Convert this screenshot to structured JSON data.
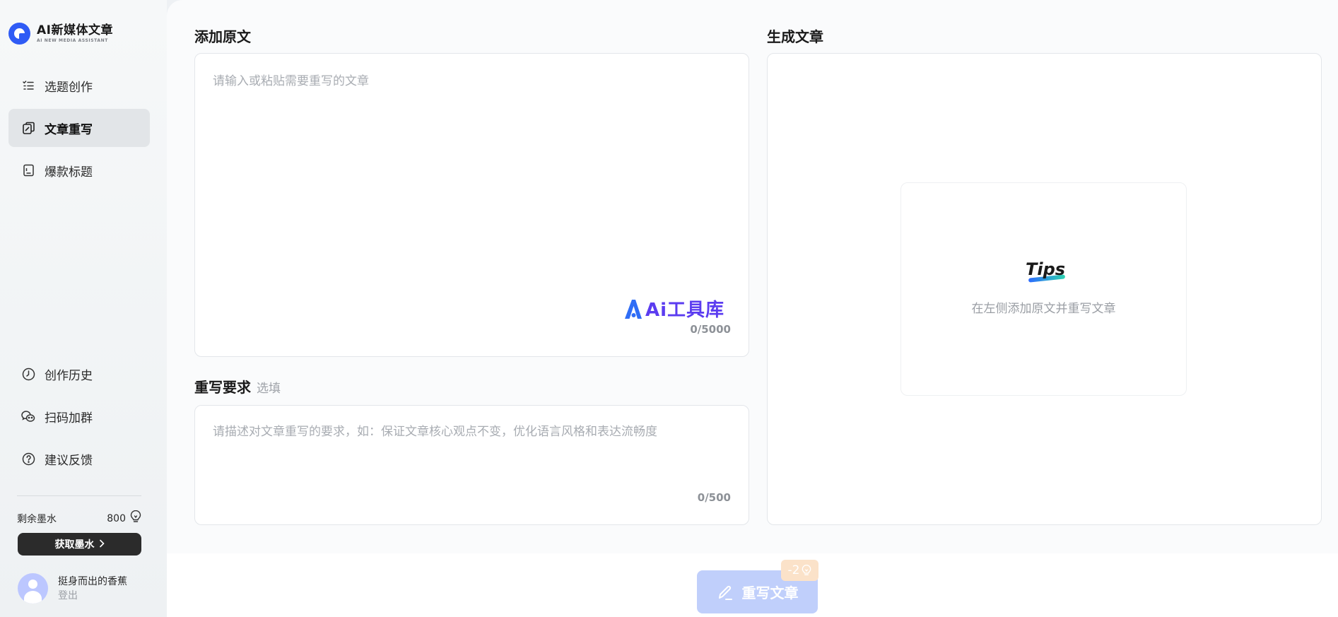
{
  "app": {
    "title": "AI新媒体文章",
    "subtitle": "AI NEW MEDIA ASSISTANT"
  },
  "sidebar": {
    "nav": [
      {
        "label": "选题创作",
        "icon": "list-icon",
        "active": false
      },
      {
        "label": "文章重写",
        "icon": "rewrite-icon",
        "active": true
      },
      {
        "label": "爆款标题",
        "icon": "document-icon",
        "active": false
      }
    ],
    "bottom_nav": [
      {
        "label": "创作历史",
        "icon": "clock-icon"
      },
      {
        "label": "扫码加群",
        "icon": "wechat-icon"
      },
      {
        "label": "建议反馈",
        "icon": "help-icon"
      }
    ],
    "ink": {
      "label": "剩余墨水",
      "value": "800",
      "icon": "bulb-icon"
    },
    "get_ink_label": "获取墨水",
    "user": {
      "name": "挺身而出的香蕉",
      "logout_label": "登出"
    }
  },
  "original": {
    "title": "添加原文",
    "placeholder": "请输入或粘贴需要重写的文章",
    "value": "",
    "counter": "0/5000",
    "watermark": "Ai工具库"
  },
  "requirements": {
    "title": "重写要求",
    "optional_label": "选填",
    "placeholder": "请描述对文章重写的要求，如：保证文章核心观点不变，优化语言风格和表达流畅度",
    "value": "",
    "counter": "0/500"
  },
  "generated": {
    "title": "生成文章",
    "tips_word": "Tips",
    "tips_hint": "在左侧添加原文并重写文章"
  },
  "action": {
    "rewrite_label": "重写文章",
    "cost_label": "-2",
    "enabled": false
  },
  "colors": {
    "accent": "#2f5bf5",
    "button_disabled": "#c0cffb",
    "badge": "#fbe2c9",
    "watermark": "#5b3cf0"
  }
}
